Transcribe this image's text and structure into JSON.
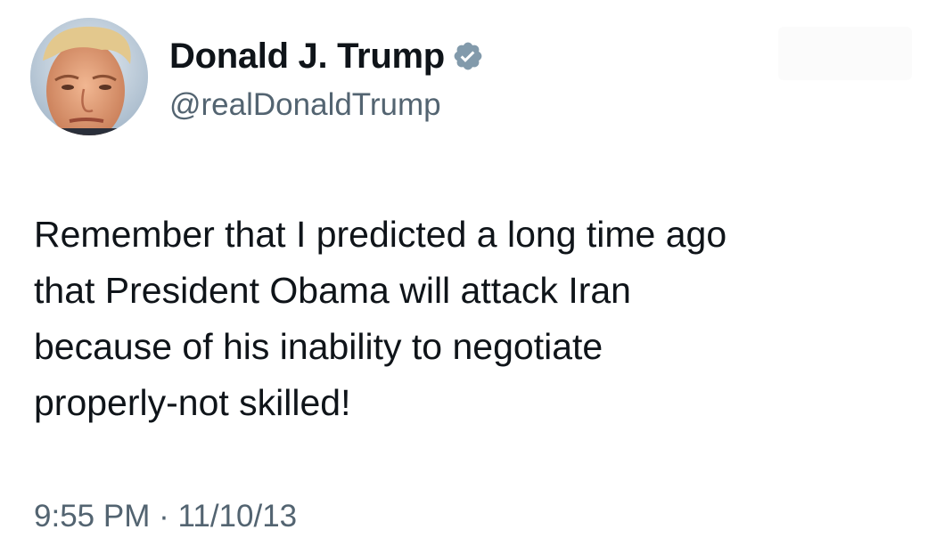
{
  "user": {
    "display_name": "Donald J. Trump",
    "handle": "@realDonaldTrump",
    "avatar_icon": "profile-photo",
    "verified_icon": "verified-badge-icon",
    "verified_color": "#829aab"
  },
  "tweet": {
    "text_lines": [
      "Remember that I predicted a long time ago",
      "that President Obama will attack Iran",
      "because of his inability to negotiate",
      "properly-not skilled!"
    ]
  },
  "meta": {
    "time": "9:55 PM",
    "separator": "·",
    "date": "11/10/13"
  },
  "colors": {
    "text": "#0f1419",
    "secondary": "#536471",
    "background": "#ffffff"
  }
}
